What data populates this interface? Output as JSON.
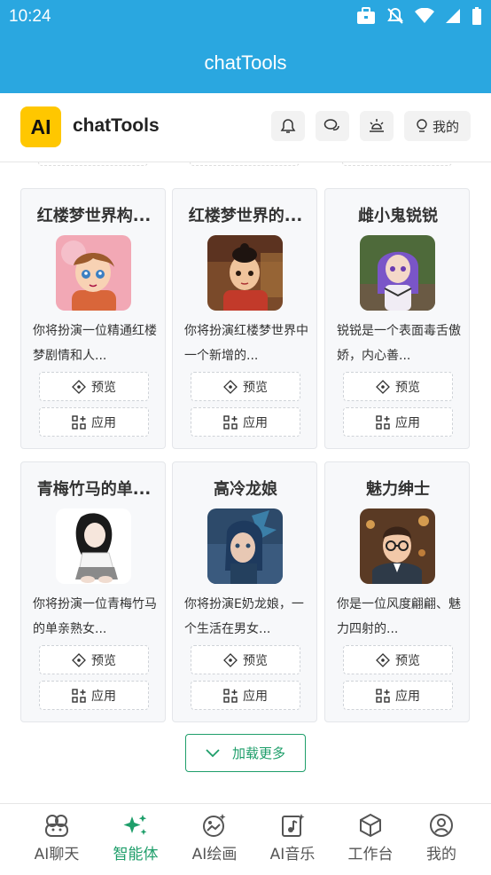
{
  "status_bar": {
    "time": "10:24"
  },
  "app_bar": {
    "title": "chatTools"
  },
  "header": {
    "logo": "AI",
    "brand": "chatTools",
    "mine_label": "我的"
  },
  "cards": [
    {
      "title": "红楼梦世界构...",
      "desc": "你将扮演一位精通红楼梦剧情和人...",
      "preview": "预览",
      "apply": "应用"
    },
    {
      "title": "红楼梦世界的...",
      "desc": "你将扮演红楼梦世界中一个新增的...",
      "preview": "预览",
      "apply": "应用"
    },
    {
      "title": "雌小鬼锐锐",
      "desc": "锐锐是一个表面毒舌傲娇，内心善...",
      "preview": "预览",
      "apply": "应用"
    },
    {
      "title": "青梅竹马的单...",
      "desc": "你将扮演一位青梅竹马的单亲熟女...",
      "preview": "预览",
      "apply": "应用"
    },
    {
      "title": "高冷龙娘",
      "desc": "你将扮演E奶龙娘，一个生活在男女...",
      "preview": "预览",
      "apply": "应用"
    },
    {
      "title": "魅力绅士",
      "desc": "你是一位风度翩翩、魅力四射的...",
      "preview": "预览",
      "apply": "应用"
    }
  ],
  "load_more": "加载更多",
  "tabs": [
    {
      "label": "AI聊天",
      "icon": "chat-bubbles-icon"
    },
    {
      "label": "智能体",
      "icon": "sparkles-icon",
      "active": true
    },
    {
      "label": "AI绘画",
      "icon": "palette-icon"
    },
    {
      "label": "AI音乐",
      "icon": "music-note-icon"
    },
    {
      "label": "工作台",
      "icon": "cube-icon"
    },
    {
      "label": "我的",
      "icon": "user-circle-icon"
    }
  ],
  "colors": {
    "primary_blue": "#2aa7e0",
    "accent_green": "#1e9e6a",
    "logo_yellow": "#ffc700"
  }
}
